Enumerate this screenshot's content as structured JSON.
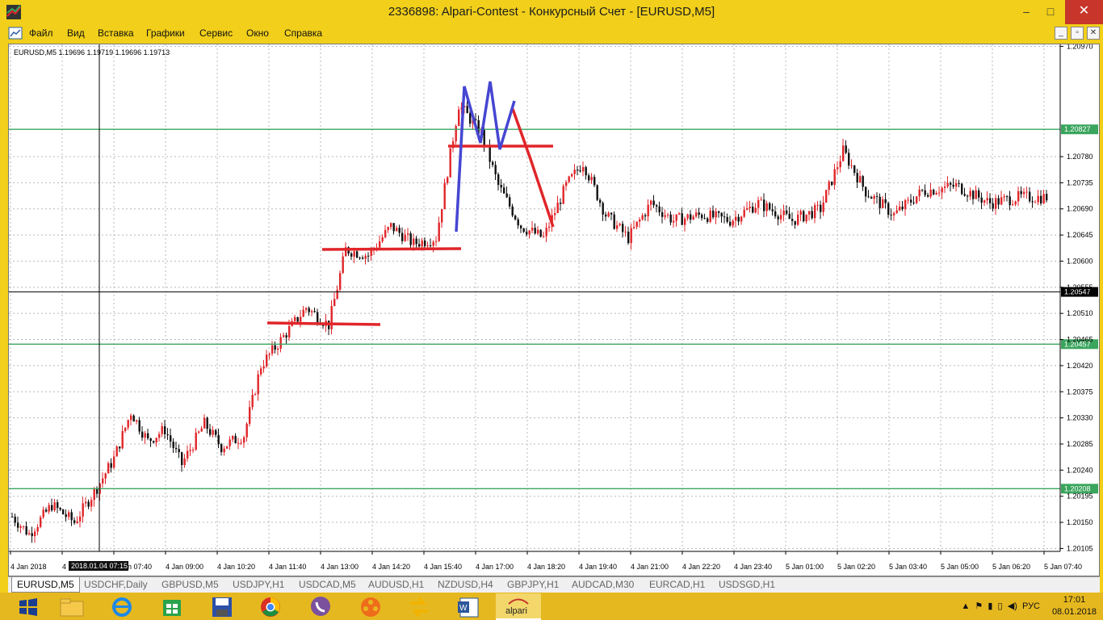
{
  "window": {
    "title": "2336898: Alpari-Contest - Конкурсный Счет - [EURUSD,M5]",
    "min_glyph": "–",
    "max_glyph": "□",
    "close_glyph": "✕"
  },
  "menu": {
    "items": [
      "Файл",
      "Вид",
      "Вставка",
      "Графики",
      "Сервис",
      "Окно",
      "Справка"
    ],
    "mdi": [
      "_",
      "▫",
      "✕"
    ]
  },
  "chart": {
    "header": "EURUSD,M5  1.19696 1.19719 1.19696 1.19713",
    "y_min": 1.201,
    "y_max": 1.20965,
    "price_labels": [
      "1.20970",
      "1.20780",
      "1.20735",
      "1.20690",
      "1.20645",
      "1.20600",
      "1.20555",
      "1.20510",
      "1.20465",
      "1.20420",
      "1.20375",
      "1.20330",
      "1.20285",
      "1.20240",
      "1.20195",
      "1.20150",
      "1.20105"
    ],
    "time_labels": [
      "4 Jan 2018",
      "4",
      "4 Jan 07:40",
      "4 Jan 09:00",
      "4 Jan 10:20",
      "4 Jan 11:40",
      "4 Jan 13:00",
      "4 Jan 14:20",
      "4 Jan 15:40",
      "4 Jan 17:00",
      "4 Jan 18:20",
      "4 Jan 19:40",
      "4 Jan 21:00",
      "4 Jan 22:20",
      "4 Jan 23:40",
      "5 Jan 01:00",
      "5 Jan 02:20",
      "5 Jan 03:40",
      "5 Jan 05:00",
      "5 Jan 06:20",
      "5 Jan 07:40"
    ],
    "crosshair_time": "2018.01.04 07:15",
    "level_lines": [
      {
        "price": 1.20827,
        "label": "1.20827",
        "color": "#3aa55d"
      },
      {
        "price": 1.20457,
        "label": "1.20457",
        "color": "#3aa55d"
      },
      {
        "price": 1.20208,
        "label": "1.20208",
        "color": "#3aa55d"
      }
    ],
    "current_price": {
      "price": 1.20547,
      "label": "1.20547",
      "color": "#000000"
    },
    "colors": {
      "up": "#e0262a",
      "down": "#111111",
      "grid": "#b8b8b8",
      "annotation_red": "#e0262a",
      "annotation_blue": "#4646d2"
    }
  },
  "chart_data": {
    "type": "candlestick",
    "title": "EURUSD,M5",
    "xlabel": "",
    "ylabel": "",
    "ylim": [
      1.201,
      1.20965
    ],
    "series": [
      {
        "name": "EURUSD,M5",
        "x": [
          "4 Jan 2018",
          "4 Jan 07:40",
          "4 Jan 09:00",
          "4 Jan 10:20",
          "4 Jan 11:40",
          "4 Jan 13:00",
          "4 Jan 14:20",
          "4 Jan 15:40",
          "4 Jan 17:00",
          "4 Jan 18:20",
          "4 Jan 19:40",
          "4 Jan 21:00",
          "4 Jan 22:20",
          "4 Jan 23:40",
          "5 Jan 01:00",
          "5 Jan 02:20",
          "5 Jan 03:40",
          "5 Jan 05:00",
          "5 Jan 06:20",
          "5 Jan 07:40"
        ],
        "values": [
          1.2016,
          1.2021,
          1.2034,
          1.2028,
          1.2047,
          1.2055,
          1.2068,
          1.2063,
          1.2087,
          1.2063,
          1.2076,
          1.2067,
          1.2067,
          1.207,
          1.207,
          1.2076,
          1.2069,
          1.2071,
          1.2071,
          1.2071
        ]
      }
    ]
  },
  "tabs": [
    {
      "label": "EURUSD,M5",
      "active": true
    },
    {
      "label": "USDCHF,Daily",
      "active": false
    },
    {
      "label": "GBPUSD,M5",
      "active": false
    },
    {
      "label": "USDJPY,H1",
      "active": false
    },
    {
      "label": "USDCAD,M5",
      "active": false
    },
    {
      "label": "AUDUSD,H1",
      "active": false
    },
    {
      "label": "NZDUSD,H4",
      "active": false
    },
    {
      "label": "GBPJPY,H1",
      "active": false
    },
    {
      "label": "AUDCAD,M30",
      "active": false
    },
    {
      "label": "EURCAD,H1",
      "active": false
    },
    {
      "label": "USDSGD,H1",
      "active": false
    }
  ],
  "taskbar": {
    "items": [
      "windows-start-icon",
      "file-explorer-icon",
      "internet-explorer-icon",
      "windows-store-icon",
      "save-disk-icon",
      "chrome-icon",
      "viber-icon",
      "video-reel-icon",
      "swap-arrow-icon",
      "word-icon",
      "alpari-icon"
    ],
    "alpari_label": "alpari",
    "lang": "РУС",
    "time": "17:01",
    "date": "08.01.2018"
  }
}
